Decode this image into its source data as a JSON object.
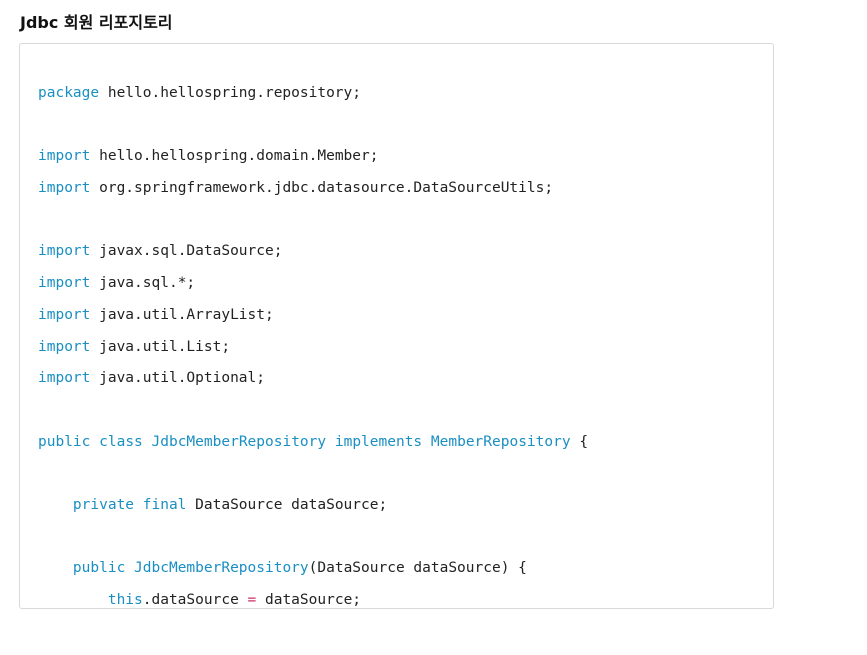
{
  "heading": "Jdbc 회원 리포지토리",
  "colors": {
    "keyword": "#1a8fc2",
    "operator": "#d0306a",
    "text": "#222222",
    "border": "#d9d9d9"
  },
  "code": {
    "lines": [
      [
        {
          "t": "kw",
          "v": "package"
        },
        {
          "t": "tx",
          "v": " hello.hellospring.repository;"
        }
      ],
      [],
      [
        {
          "t": "kw",
          "v": "import"
        },
        {
          "t": "tx",
          "v": " hello.hellospring.domain.Member;"
        }
      ],
      [
        {
          "t": "kw",
          "v": "import"
        },
        {
          "t": "tx",
          "v": " org.springframework.jdbc.datasource.DataSourceUtils;"
        }
      ],
      [],
      [
        {
          "t": "kw",
          "v": "import"
        },
        {
          "t": "tx",
          "v": " javax.sql.DataSource;"
        }
      ],
      [
        {
          "t": "kw",
          "v": "import"
        },
        {
          "t": "tx",
          "v": " java.sql.*;"
        }
      ],
      [
        {
          "t": "kw",
          "v": "import"
        },
        {
          "t": "tx",
          "v": " java.util.ArrayList;"
        }
      ],
      [
        {
          "t": "kw",
          "v": "import"
        },
        {
          "t": "tx",
          "v": " java.util.List;"
        }
      ],
      [
        {
          "t": "kw",
          "v": "import"
        },
        {
          "t": "tx",
          "v": " java.util.Optional;"
        }
      ],
      [],
      [
        {
          "t": "kw",
          "v": "public"
        },
        {
          "t": "tx",
          "v": " "
        },
        {
          "t": "kw",
          "v": "class"
        },
        {
          "t": "tx",
          "v": " "
        },
        {
          "t": "ty",
          "v": "JdbcMemberRepository"
        },
        {
          "t": "tx",
          "v": " "
        },
        {
          "t": "kw",
          "v": "implements"
        },
        {
          "t": "tx",
          "v": " "
        },
        {
          "t": "ty",
          "v": "MemberRepository"
        },
        {
          "t": "tx",
          "v": " {"
        }
      ],
      [],
      [
        {
          "t": "tx",
          "v": "    "
        },
        {
          "t": "kw",
          "v": "private"
        },
        {
          "t": "tx",
          "v": " "
        },
        {
          "t": "kw",
          "v": "final"
        },
        {
          "t": "tx",
          "v": " DataSource dataSource;"
        }
      ],
      [],
      [
        {
          "t": "tx",
          "v": "    "
        },
        {
          "t": "kw",
          "v": "public"
        },
        {
          "t": "tx",
          "v": " "
        },
        {
          "t": "fn",
          "v": "JdbcMemberRepository"
        },
        {
          "t": "tx",
          "v": "(DataSource dataSource) {"
        }
      ],
      [
        {
          "t": "tx",
          "v": "        "
        },
        {
          "t": "kw",
          "v": "this"
        },
        {
          "t": "tx",
          "v": ".dataSource "
        },
        {
          "t": "op",
          "v": "="
        },
        {
          "t": "tx",
          "v": " dataSource;"
        }
      ]
    ]
  }
}
